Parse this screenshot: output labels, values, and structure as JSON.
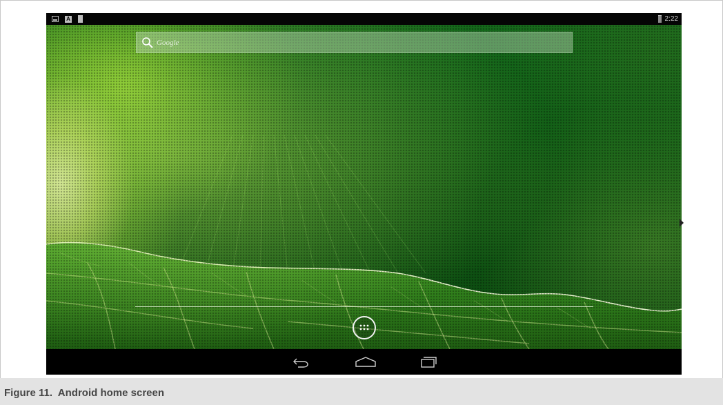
{
  "status_bar": {
    "left_icons": [
      "screenshot-icon",
      "keyboard-a-icon",
      "sd-card-icon"
    ],
    "battery_icon": "battery-icon",
    "time": "2:22"
  },
  "search": {
    "icon": "search-icon",
    "placeholder": "Google"
  },
  "dock": {
    "app_drawer_icon": "all-apps-grid-icon"
  },
  "navigation": {
    "buttons": [
      "back-icon",
      "home-icon",
      "recents-icon"
    ]
  },
  "caption": "Figure 11.  Android home screen",
  "colors": {
    "status_bar_bg": "#050505",
    "nav_bar_bg": "#000000",
    "wallpaper_green": "#0f5a14",
    "caption_bg": "#e3e3e3",
    "caption_text": "#474747"
  }
}
